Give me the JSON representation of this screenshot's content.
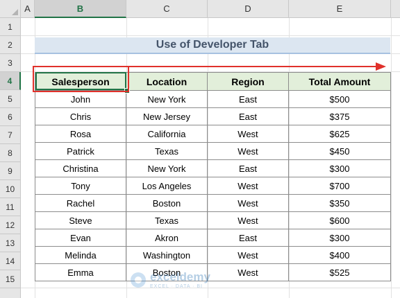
{
  "columns": [
    "A",
    "B",
    "C",
    "D",
    "E"
  ],
  "rows": [
    "1",
    "2",
    "3",
    "4",
    "5",
    "6",
    "7",
    "8",
    "9",
    "10",
    "11",
    "12",
    "13",
    "14",
    "15"
  ],
  "title": "Use of Developer Tab",
  "table": {
    "headers": [
      "Salesperson",
      "Location",
      "Region",
      "Total Amount"
    ],
    "rows": [
      [
        "John",
        "New York",
        "East",
        "$500"
      ],
      [
        "Chris",
        "New Jersey",
        "East",
        "$375"
      ],
      [
        "Rosa",
        "California",
        "West",
        "$625"
      ],
      [
        "Patrick",
        "Texas",
        "West",
        "$450"
      ],
      [
        "Christina",
        "New York",
        "East",
        "$300"
      ],
      [
        "Tony",
        "Los Angeles",
        "West",
        "$700"
      ],
      [
        "Rachel",
        "Boston",
        "West",
        "$350"
      ],
      [
        "Steve",
        "Texas",
        "West",
        "$600"
      ],
      [
        "Evan",
        "Akron",
        "East",
        "$300"
      ],
      [
        "Melinda",
        "Washington",
        "West",
        "$400"
      ],
      [
        "Emma",
        "Boston",
        "West",
        "$525"
      ]
    ]
  },
  "selection": {
    "active_cell": "B4"
  },
  "colors": {
    "accent_red": "#e0312b",
    "excel_green": "#217346",
    "header_fill": "#e2efda",
    "title_fill": "#dce6f1"
  },
  "watermark": {
    "name": "exceldemy",
    "tagline": "EXCEL · DATA · BI"
  }
}
